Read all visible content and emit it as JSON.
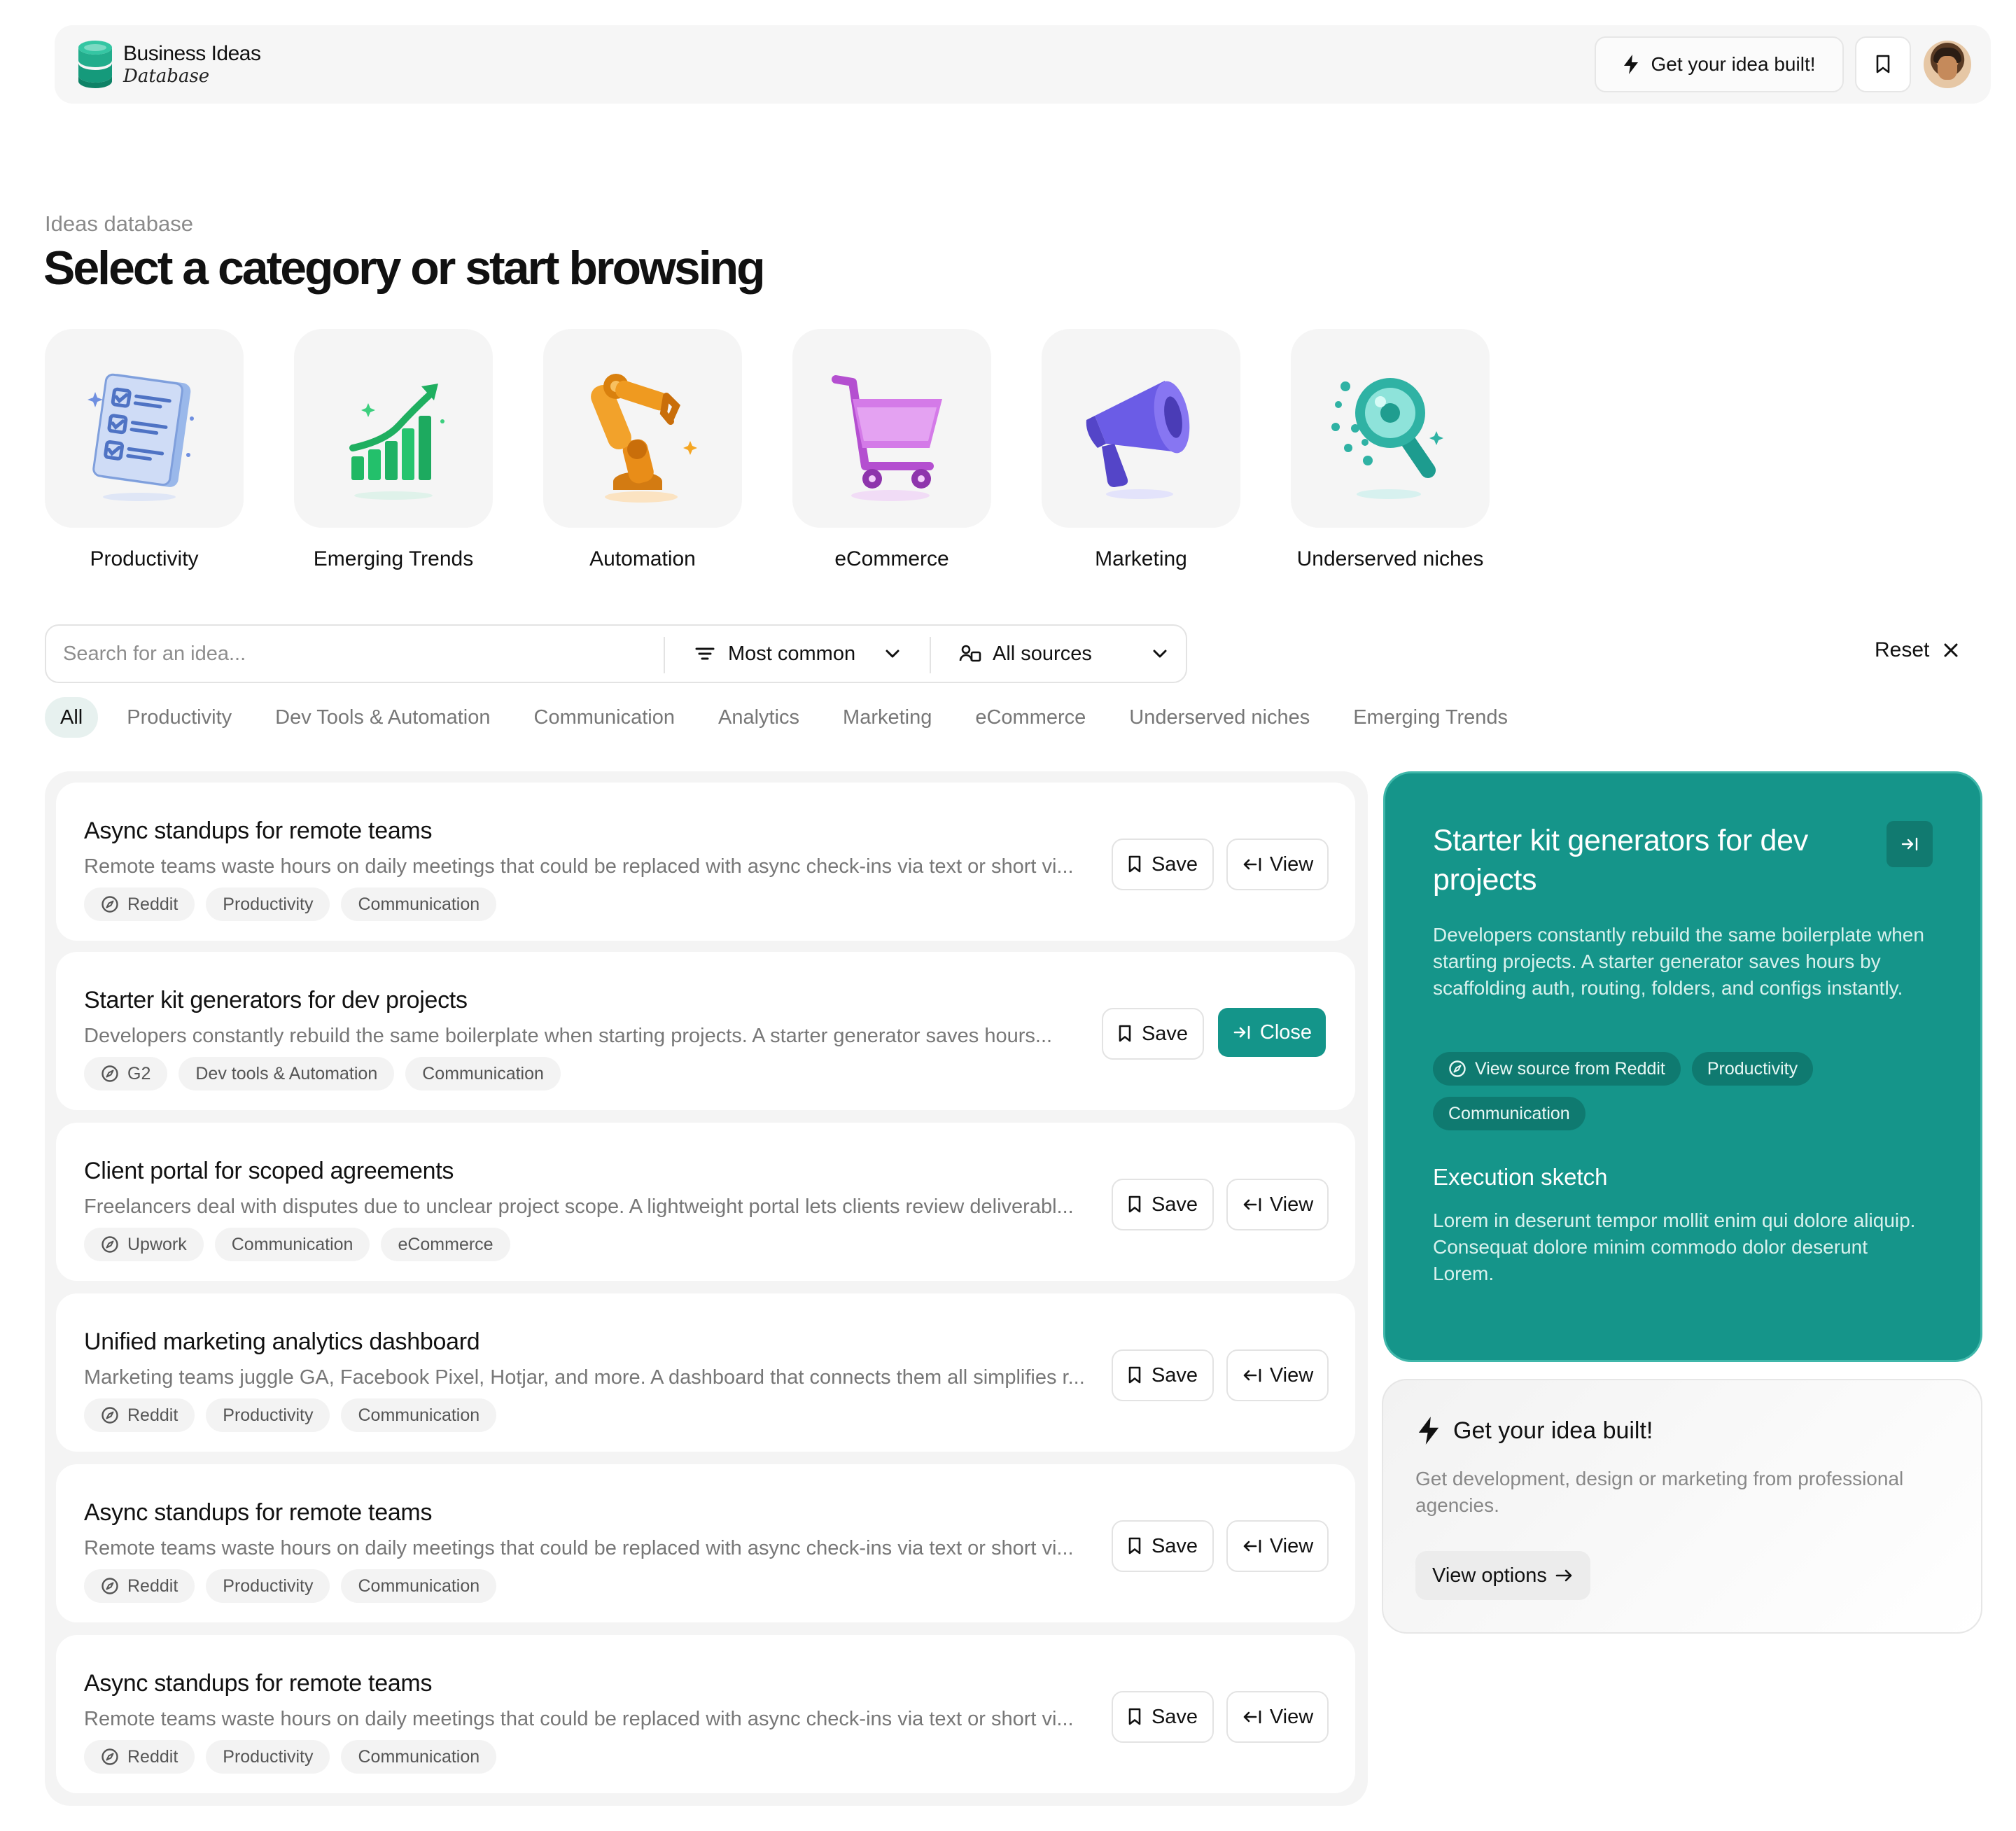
{
  "header": {
    "logo_title": "Business Ideas",
    "logo_subtitle": "Database",
    "cta_label": "Get your idea built!"
  },
  "hero": {
    "eyebrow": "Ideas database",
    "title": "Select a category or start browsing"
  },
  "categories": [
    {
      "label": "Productivity",
      "icon": "checklist-icon"
    },
    {
      "label": "Emerging Trends",
      "icon": "growth-chart-icon"
    },
    {
      "label": "Automation",
      "icon": "robot-arm-icon"
    },
    {
      "label": "eCommerce",
      "icon": "shopping-cart-icon"
    },
    {
      "label": "Marketing",
      "icon": "megaphone-icon"
    },
    {
      "label": "Underserved niches",
      "icon": "magnifier-icon"
    }
  ],
  "filters": {
    "search_placeholder": "Search for an idea...",
    "sort_value": "Most common",
    "source_value": "All sources",
    "reset_label": "Reset"
  },
  "tabs": [
    "All",
    "Productivity",
    "Dev Tools & Automation",
    "Communication",
    "Analytics",
    "Marketing",
    "eCommerce",
    "Underserved niches",
    "Emerging Trends"
  ],
  "ideas": [
    {
      "title": "Async standups for remote teams",
      "description": "Remote teams waste hours on daily meetings that could be replaced with async check-ins via text or short vi...",
      "tags": [
        "Reddit",
        "Productivity",
        "Communication"
      ],
      "save_label": "Save",
      "action_label": "View"
    },
    {
      "title": "Starter kit generators for dev projects",
      "description": "Developers constantly rebuild the same boilerplate when starting projects. A starter generator saves hours...",
      "tags": [
        "G2",
        "Dev tools & Automation",
        "Communication"
      ],
      "save_label": "Save",
      "action_label": "Close"
    },
    {
      "title": "Client portal for scoped agreements",
      "description": "Freelancers deal with disputes due to unclear project scope. A lightweight portal lets clients review deliverabl...",
      "tags": [
        "Upwork",
        "Communication",
        "eCommerce"
      ],
      "save_label": "Save",
      "action_label": "View"
    },
    {
      "title": "Unified marketing analytics dashboard",
      "description": "Marketing teams juggle GA, Facebook Pixel, Hotjar, and more. A dashboard that connects them all simplifies r...",
      "tags": [
        "Reddit",
        "Productivity",
        "Communication"
      ],
      "save_label": "Save",
      "action_label": "View"
    },
    {
      "title": "Async standups for remote teams",
      "description": "Remote teams waste hours on daily meetings that could be replaced with async check-ins via text or short vi...",
      "tags": [
        "Reddit",
        "Productivity",
        "Communication"
      ],
      "save_label": "Save",
      "action_label": "View"
    },
    {
      "title": "Async standups for remote teams",
      "description": "Remote teams waste hours on daily meetings that could be replaced with async check-ins via text or short vi...",
      "tags": [
        "Reddit",
        "Productivity",
        "Communication"
      ],
      "save_label": "Save",
      "action_label": "View"
    }
  ],
  "detail": {
    "title": "Starter kit generators for dev projects",
    "description": "Developers constantly rebuild the same boilerplate when starting projects. A starter generator saves hours by scaffolding auth, routing, folders, and configs instantly.",
    "tags": [
      "View source from Reddit",
      "Productivity",
      "Communication"
    ],
    "exec_title": "Execution sketch",
    "exec_body": "Lorem in deserunt tempor mollit enim qui dolore aliquip. Consequat dolore minim commodo dolor deserunt Lorem."
  },
  "promo": {
    "title": "Get your idea built!",
    "body": "Get development, design or marketing from professional agencies.",
    "button_label": "View options"
  },
  "colors": {
    "accent": "#15958a",
    "accent_dark": "#0f7a70",
    "tab_active_bg": "#e7f1ef"
  }
}
